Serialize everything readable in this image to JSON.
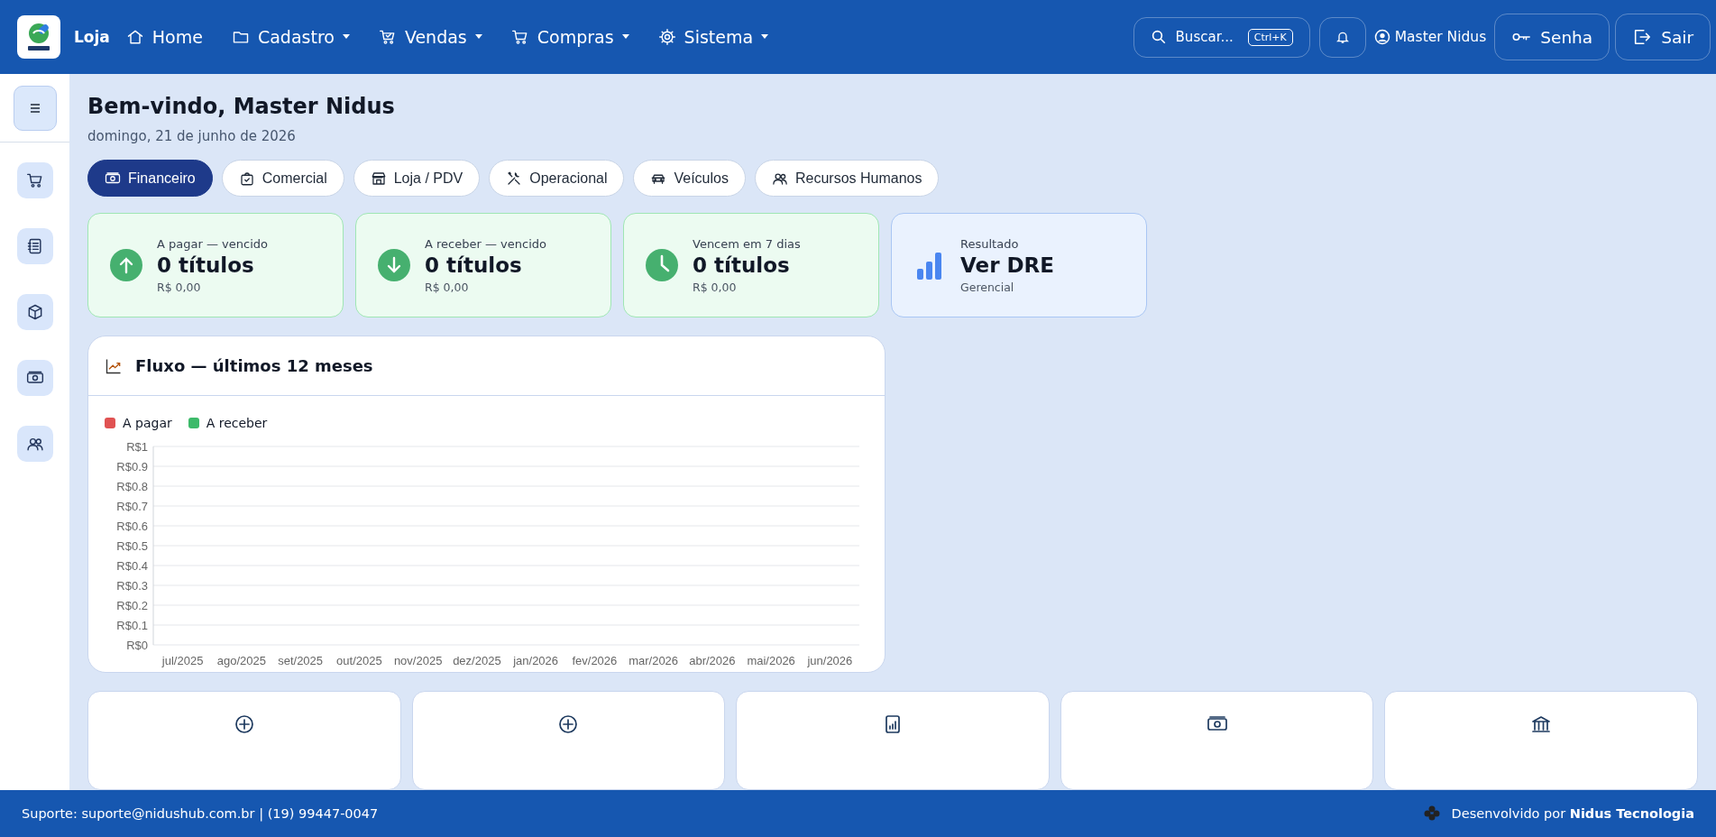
{
  "header": {
    "brand": "Loja",
    "nav": [
      {
        "label": "Home",
        "kind": "home",
        "dropdown": false
      },
      {
        "label": "Cadastro",
        "kind": "folder",
        "dropdown": true
      },
      {
        "label": "Vendas",
        "kind": "cart-check",
        "dropdown": true
      },
      {
        "label": "Compras",
        "kind": "cart",
        "dropdown": true
      },
      {
        "label": "Sistema",
        "kind": "gear",
        "dropdown": true
      }
    ],
    "search": {
      "label": "Buscar...",
      "shortcut": "Ctrl+K"
    },
    "user": "Master Nidus",
    "buttons": [
      {
        "label": "Senha",
        "kind": "key"
      },
      {
        "label": "Sair",
        "kind": "exit"
      }
    ]
  },
  "sidebar": {
    "items": [
      {
        "kind": "cart"
      },
      {
        "kind": "notebook"
      },
      {
        "kind": "box"
      },
      {
        "kind": "cash"
      },
      {
        "kind": "people"
      }
    ]
  },
  "greeting": {
    "title": "Bem-vindo, Master Nidus",
    "date": "domingo, 21 de junho de 2026"
  },
  "tabs": [
    {
      "label": "Financeiro",
      "kind": "cash",
      "selected": true
    },
    {
      "label": "Comercial",
      "kind": "bag",
      "selected": false
    },
    {
      "label": "Loja / PDV",
      "kind": "store",
      "selected": false
    },
    {
      "label": "Operacional",
      "kind": "tools",
      "selected": false
    },
    {
      "label": "Veículos",
      "kind": "car",
      "selected": false
    },
    {
      "label": "Recursos Humanos",
      "kind": "people",
      "selected": false
    }
  ],
  "stats": [
    {
      "kind": "up",
      "label": "A pagar — vencido",
      "value": "0 títulos",
      "sub": "R$ 0,00"
    },
    {
      "kind": "down",
      "label": "A receber — vencido",
      "value": "0 títulos",
      "sub": "R$ 0,00"
    },
    {
      "kind": "clock",
      "label": "Vencem em 7 dias",
      "value": "0 títulos",
      "sub": "R$ 0,00"
    },
    {
      "kind": "report",
      "label": "Resultado",
      "value": "Ver DRE",
      "sub": "Gerencial"
    }
  ],
  "chart_panel": {
    "title": "Fluxo — últimos 12 meses",
    "legend": [
      {
        "name": "A pagar",
        "color": "#e05252"
      },
      {
        "name": "A receber",
        "color": "#3dba6a"
      }
    ],
    "y_labels": [
      "R$1",
      "R$0.9",
      "R$0.8",
      "R$0.7",
      "R$0.6",
      "R$0.5",
      "R$0.4",
      "R$0.3",
      "R$0.2",
      "R$0.1",
      "R$0"
    ],
    "x_labels": [
      "jul/2025",
      "ago/2025",
      "set/2025",
      "out/2025",
      "nov/2025",
      "dez/2025",
      "jan/2026",
      "fev/2026",
      "mar/2026",
      "abr/2026",
      "mai/2026",
      "jun/2026"
    ]
  },
  "quick_actions": [
    {
      "kind": "plus"
    },
    {
      "kind": "plus"
    },
    {
      "kind": "report"
    },
    {
      "kind": "cash"
    },
    {
      "kind": "bank"
    }
  ],
  "footer": {
    "support": "Suporte: suporte@nidushub.com.br | (19) 99447-0047",
    "credit": "Desenvolvido por **Nidus Tecnologia**"
  }
}
